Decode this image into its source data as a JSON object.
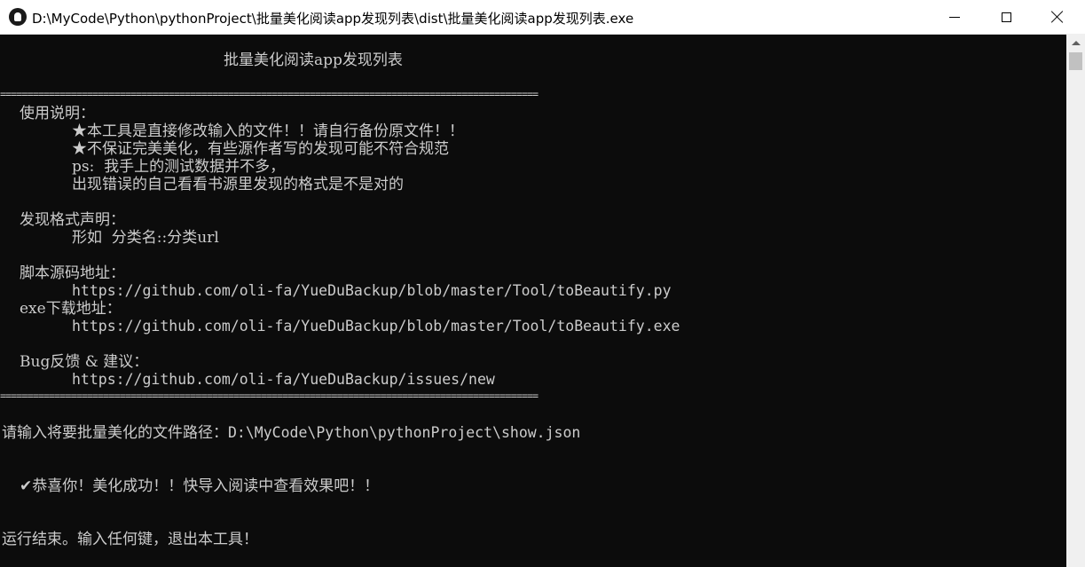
{
  "window": {
    "title": "D:\\MyCode\\Python\\pythonProject\\批量美化阅读app发现列表\\dist\\批量美化阅读app发现列表.exe"
  },
  "console": {
    "header_title": "批量美化阅读app发现列表",
    "separator": "===================================================================================================",
    "usage_heading": "使用说明：",
    "usage_1": "★本工具是直接修改输入的文件！！请自行备份原文件！！",
    "usage_2": "★不保证完美美化，有些源作者写的发现可能不符合规范",
    "usage_3": "ps:  我手上的测试数据并不多，",
    "usage_4": "出现错误的自己看看书源里发现的格式是不是对的",
    "format_heading": "发现格式声明：",
    "format_body": "形如  分类名::分类url",
    "script_heading": "脚本源码地址：",
    "script_url": "https://github.com/oli-fa/YueDuBackup/blob/master/Tool/toBeautify.py",
    "exe_heading": "exe下载地址：",
    "exe_url": "https://github.com/oli-fa/YueDuBackup/blob/master/Tool/toBeautify.exe",
    "bug_heading": "Bug反馈 & 建议：",
    "bug_url": "https://github.com/oli-fa/YueDuBackup/issues/new",
    "prompt_label": "请输入将要批量美化的文件路径：",
    "prompt_value": "D:\\MyCode\\Python\\pythonProject\\show.json",
    "success_mark": "✔",
    "success_text": "恭喜你！美化成功！！快导入阅读中查看效果吧！！",
    "exit_text": "运行结束。输入任何键，退出本工具！"
  },
  "colors": {
    "console_bg": "#0c0c0c",
    "console_text": "#cccccc",
    "titlebar_bg": "#ffffff"
  },
  "icons": {
    "app": "console-app-icon",
    "minimize": "minimize-icon",
    "maximize": "maximize-icon",
    "close": "close-icon",
    "scroll_up": "scroll-up-arrow-icon"
  }
}
